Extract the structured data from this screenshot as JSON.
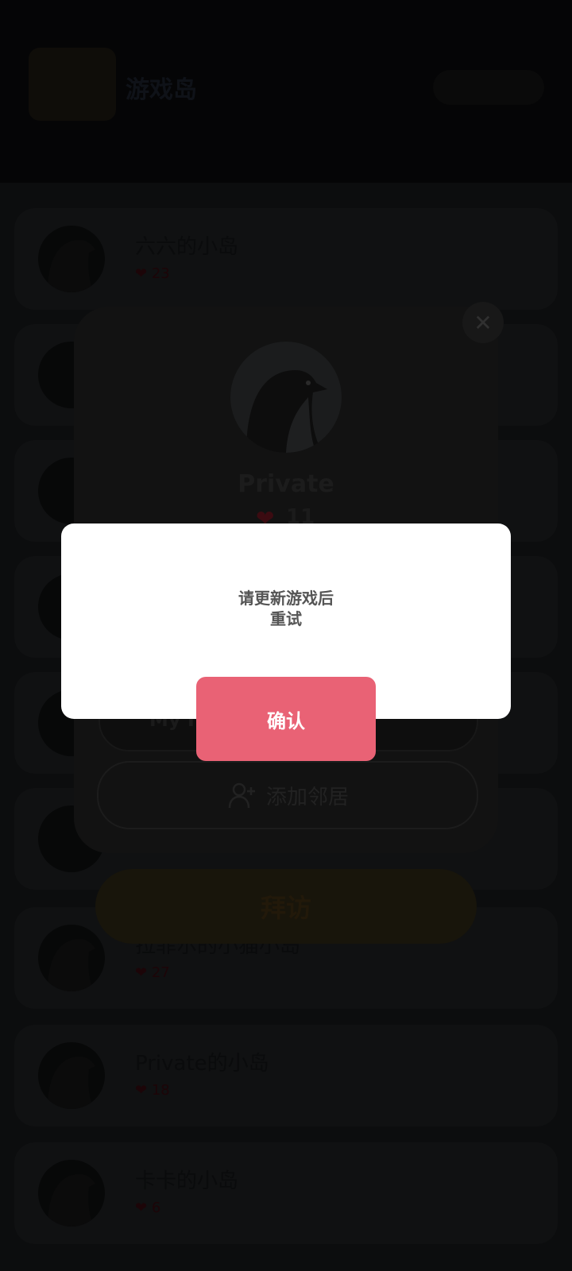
{
  "app": {
    "logo_text": "游戏岛",
    "header_sub": "",
    "visit_label": "拜访"
  },
  "list": [
    {
      "name": "六六的小岛",
      "likes": "23"
    },
    {
      "name": "",
      "likes": ""
    },
    {
      "name": "",
      "likes": ""
    },
    {
      "name": "",
      "likes": ""
    },
    {
      "name": "",
      "likes": ""
    },
    {
      "name": "",
      "likes": ""
    },
    {
      "name": "拉菲尔的小猫小岛",
      "likes": "27"
    },
    {
      "name": "Private的小岛",
      "likes": "18"
    },
    {
      "name": "卡卡的小岛",
      "likes": "6"
    }
  ],
  "profile": {
    "name": "Private",
    "likes": "11",
    "my_button_label": "My I",
    "add_neighbor_label": "添加邻居",
    "close_icon": "close-icon"
  },
  "alert": {
    "message_line1": "请更新游戏后",
    "message_line2": "重试",
    "confirm_label": "确认"
  },
  "colors": {
    "confirm": "#e96275",
    "alert_bg": "#ffffff",
    "overlay": "#000000"
  }
}
